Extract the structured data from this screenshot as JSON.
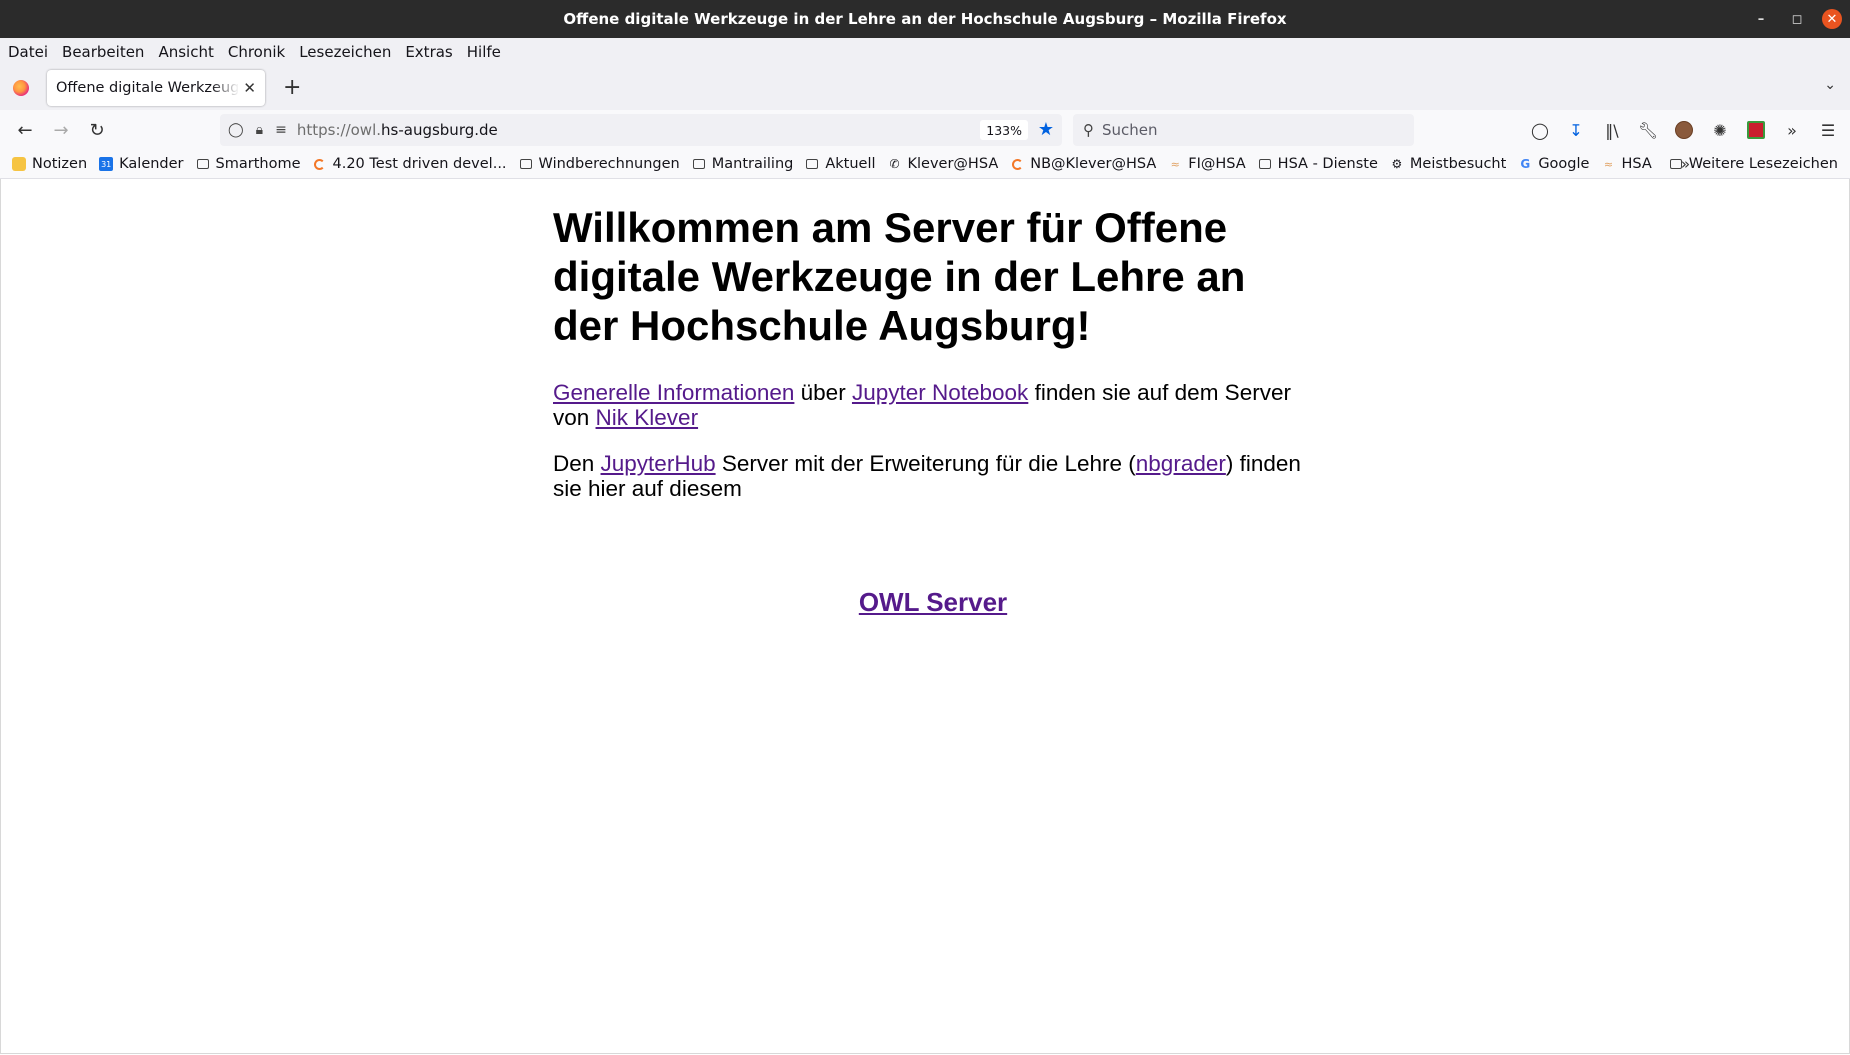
{
  "window": {
    "title": "Offene digitale Werkzeuge in der Lehre an der Hochschule Augsburg – Mozilla Firefox"
  },
  "menu": [
    "Datei",
    "Bearbeiten",
    "Ansicht",
    "Chronik",
    "Lesezeichen",
    "Extras",
    "Hilfe"
  ],
  "tab": {
    "title": "Offene digitale Werkzeuge in der Lehre an der Hochschule Augsburg"
  },
  "urlbar": {
    "url_prefix": "https://owl.",
    "url_domain": "hs-augsburg.de",
    "zoom": "133%"
  },
  "search": {
    "placeholder": "Suchen"
  },
  "bookmarks": [
    {
      "label": "Notizen",
      "icon": "notes-icon"
    },
    {
      "label": "Kalender",
      "icon": "calendar-icon"
    },
    {
      "label": "Smarthome",
      "icon": "folder-icon"
    },
    {
      "label": "4.20 Test driven devel...",
      "icon": "jupyter-icon"
    },
    {
      "label": "Windberechnungen",
      "icon": "folder-icon"
    },
    {
      "label": "Mantrailing",
      "icon": "folder-icon"
    },
    {
      "label": "Aktuell",
      "icon": "folder-icon"
    },
    {
      "label": "Klever@HSA",
      "icon": "phone-icon"
    },
    {
      "label": "NB@Klever@HSA",
      "icon": "jupyter-icon"
    },
    {
      "label": "FI@HSA",
      "icon": "hsa-icon"
    },
    {
      "label": "HSA - Dienste",
      "icon": "folder-icon"
    },
    {
      "label": "Meistbesucht",
      "icon": "gear-icon"
    },
    {
      "label": "Google",
      "icon": "google-icon"
    },
    {
      "label": "HSA",
      "icon": "hsa-icon"
    }
  ],
  "bookmarks_other": "Weitere Lesezeichen",
  "page": {
    "heading": "Willkommen am Server für Offene digitale Werkzeuge in der Lehre an der Hochschule Augsburg!",
    "p1": {
      "link1": "Generelle Informationen",
      "text1": " über ",
      "link2": "Jupyter Notebook",
      "text2": " finden sie auf dem Server von ",
      "link3": "Nik Klever"
    },
    "p2": {
      "text1": "Den ",
      "link1": "JupyterHub",
      "text2": " Server mit der Erweiterung für die Lehre (",
      "link2": "nbgrader",
      "text3": ") finden sie hier auf diesem"
    },
    "server_link": "OWL Server"
  },
  "colors": {
    "link": "#551a8b",
    "bookmark_star": "#0061e0",
    "titlebar": "#2b2b2b",
    "close_button": "#e95420"
  }
}
